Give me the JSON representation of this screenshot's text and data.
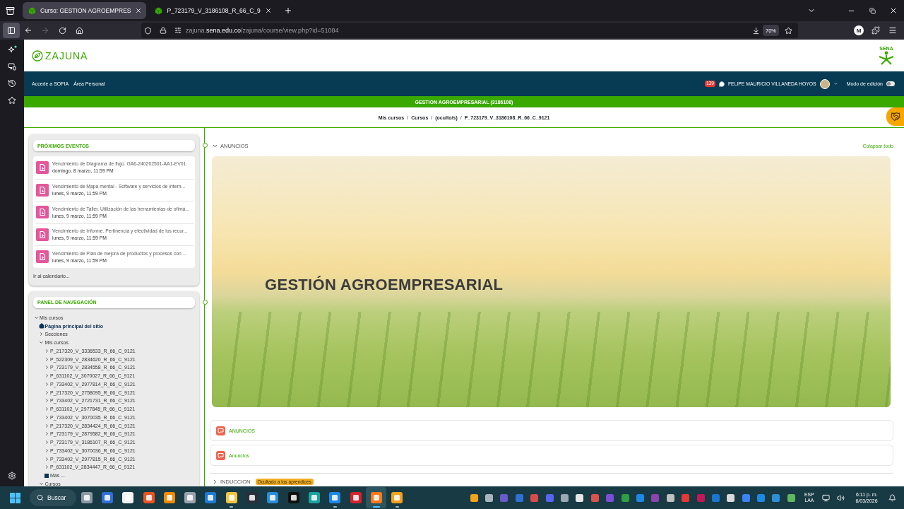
{
  "browser": {
    "tabs": [
      {
        "title": "Curso: GESTION AGROEMPRES",
        "selected": true
      },
      {
        "title": "P_723179_V_3186108_R_66_C_9",
        "selected": false
      }
    ],
    "address": "zajuna.**sena.edu.co**/zajuna/course/view.php?id=51084",
    "forward_disabled": true,
    "zoom": "70%",
    "profile_initial": "M"
  },
  "site": {
    "logo_text": "ZAJUNA",
    "sena_logo_text": "SENA",
    "nav_links": [
      "Accede a SOFIA",
      "Área Personal"
    ],
    "notification_count": "139",
    "user_name": "FELIPE MAURICIO VILLANEDA HOYOS",
    "edit_mode": {
      "label": "Modo de edición",
      "on": false
    },
    "course_title": "GESTION AGROEMPRESARIAL (3186108)",
    "breadcrumb": {
      "separator": "/",
      "items": [
        "Mis cursos",
        "Cursos",
        "(oculto/s)",
        "P_723179_V_3186108_R_66_C_9121"
      ]
    }
  },
  "upcoming_events": {
    "title": "PRÓXIMOS EVENTOS",
    "items": [
      {
        "title": "Vencimiento de Diagrama de flujo. GA6-240202501-AA1-EV01.",
        "date": "domingo, 8 marzo, 11:59 PM"
      },
      {
        "title": "Vencimiento de Mapa mental - Software y servicios de intern...",
        "date": "lunes, 9 marzo, 11:59 PM"
      },
      {
        "title": "Vencimiento de Taller. Utilización de las herramientas de ofimá...",
        "date": "lunes, 9 marzo, 11:59 PM"
      },
      {
        "title": "Vencimiento de Informe. Pertinencia y efectividad de los recur...",
        "date": "lunes, 9 marzo, 11:59 PM"
      },
      {
        "title": "Vencimiento de Plan de mejora de productos y procesos con ...",
        "date": "lunes, 9 marzo, 11:59 PM"
      }
    ],
    "footer_link": "Ir al calendario..."
  },
  "nav_panel": {
    "title": "PANEL DE NAVEGACIÓN",
    "tree": [
      {
        "label": "Mis cursos",
        "kind": "branch",
        "expanded": true,
        "children": [
          {
            "label": "Página principal del sitio",
            "kind": "home"
          },
          {
            "label": "Secciones",
            "kind": "branch",
            "expanded": false
          },
          {
            "label": "Mis cursos",
            "kind": "branch",
            "expanded": true,
            "children": [
              {
                "label": "P_217320_V_3336533_R_66_C_9121",
                "kind": "branch",
                "expanded": false
              },
              {
                "label": "P_522309_V_2834620_R_66_C_9121",
                "kind": "branch",
                "expanded": false
              },
              {
                "label": "P_723179_V_2834558_R_66_C_9121",
                "kind": "branch",
                "expanded": false
              },
              {
                "label": "P_631102_V_3070027_R_66_C_9121",
                "kind": "branch",
                "expanded": false
              },
              {
                "label": "P_733402_V_2977814_R_66_C_9121",
                "kind": "branch",
                "expanded": false
              },
              {
                "label": "P_217320_V_2758095_R_66_C_9121",
                "kind": "branch",
                "expanded": false
              },
              {
                "label": "P_733402_V_2721731_R_66_C_9121",
                "kind": "branch",
                "expanded": false
              },
              {
                "label": "P_631102_V_2977845_R_66_C_9121",
                "kind": "branch",
                "expanded": false
              },
              {
                "label": "P_733402_V_3070035_R_66_C_9121",
                "kind": "branch",
                "expanded": false
              },
              {
                "label": "P_217320_V_2834424_R_66_C_9121",
                "kind": "branch",
                "expanded": false
              },
              {
                "label": "P_723179_V_2879582_R_66_C_9121",
                "kind": "branch",
                "expanded": false
              },
              {
                "label": "P_723179_V_3186107_R_66_C_9121",
                "kind": "branch",
                "expanded": false
              },
              {
                "label": "P_733402_V_3070036_R_66_C_9121",
                "kind": "branch",
                "expanded": false
              },
              {
                "label": "P_733402_V_2977815_R_66_C_9121",
                "kind": "branch",
                "expanded": false
              },
              {
                "label": "P_631102_V_2834447_R_66_C_9121",
                "kind": "branch",
                "expanded": false
              },
              {
                "label": "Más ...",
                "kind": "more"
              }
            ]
          },
          {
            "label": "Cursos",
            "kind": "branch",
            "expanded": true
          }
        ]
      }
    ]
  },
  "course": {
    "collapse_all": "Colapsar todo",
    "sections": [
      {
        "title": "ANUNCIOS",
        "expanded": true,
        "banner_title": "GESTIÓN AGROEMPRESARIAL",
        "activities": [
          {
            "name": "ANUNCIOS"
          },
          {
            "name": "Anuncios"
          }
        ]
      },
      {
        "title": "INDUCCION",
        "expanded": false,
        "badge": "Ocultado a los aprendices"
      }
    ]
  },
  "taskbar": {
    "search": "Buscar",
    "apps": [
      {
        "running": false,
        "active": false
      },
      {
        "running": false,
        "active": false
      },
      {
        "running": false,
        "active": false
      },
      {
        "running": false,
        "active": false
      },
      {
        "running": false,
        "active": false
      },
      {
        "running": false,
        "active": false
      },
      {
        "running": false,
        "active": false
      },
      {
        "running": true,
        "active": false
      },
      {
        "running": false,
        "active": false
      },
      {
        "running": false,
        "active": false
      },
      {
        "running": false,
        "active": false
      },
      {
        "running": false,
        "active": false
      },
      {
        "running": true,
        "active": false
      },
      {
        "running": false,
        "active": false
      },
      {
        "running": true,
        "active": true
      },
      {
        "running": true,
        "active": false
      }
    ],
    "language": [
      "ESP",
      "LAA"
    ],
    "time": "6:11 p. m.",
    "date": "6/03/2026"
  }
}
